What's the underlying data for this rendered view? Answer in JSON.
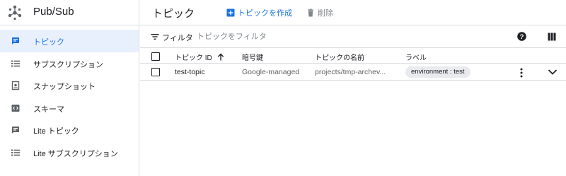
{
  "app": {
    "title": "Pub/Sub"
  },
  "sidebar": {
    "items": [
      {
        "label": "トピック",
        "icon": "message-icon",
        "active": true
      },
      {
        "label": "サブスクリプション",
        "icon": "list-icon",
        "active": false
      },
      {
        "label": "スナップショット",
        "icon": "snapshot-icon",
        "active": false
      },
      {
        "label": "スキーマ",
        "icon": "code-icon",
        "active": false
      },
      {
        "label": "Lite トピック",
        "icon": "message-icon",
        "active": false
      },
      {
        "label": "Lite サブスクリプション",
        "icon": "list-icon",
        "active": false
      }
    ]
  },
  "header": {
    "title": "トピック",
    "create_label": "トピックを作成",
    "delete_label": "削除"
  },
  "filter": {
    "label": "フィルタ",
    "placeholder": "トピックをフィルタ"
  },
  "table": {
    "columns": {
      "id": "トピック ID",
      "key": "暗号鍵",
      "name": "トピックの名前",
      "label": "ラベル"
    },
    "rows": [
      {
        "id": "test-topic",
        "key": "Google-managed",
        "name": "projects/tmp-archev...",
        "label": "environment : test"
      }
    ]
  },
  "colors": {
    "accent": "#1a73e8",
    "active_bg": "#e8f0fe",
    "chip_bg": "#e8eaed",
    "border": "#dadce0"
  }
}
